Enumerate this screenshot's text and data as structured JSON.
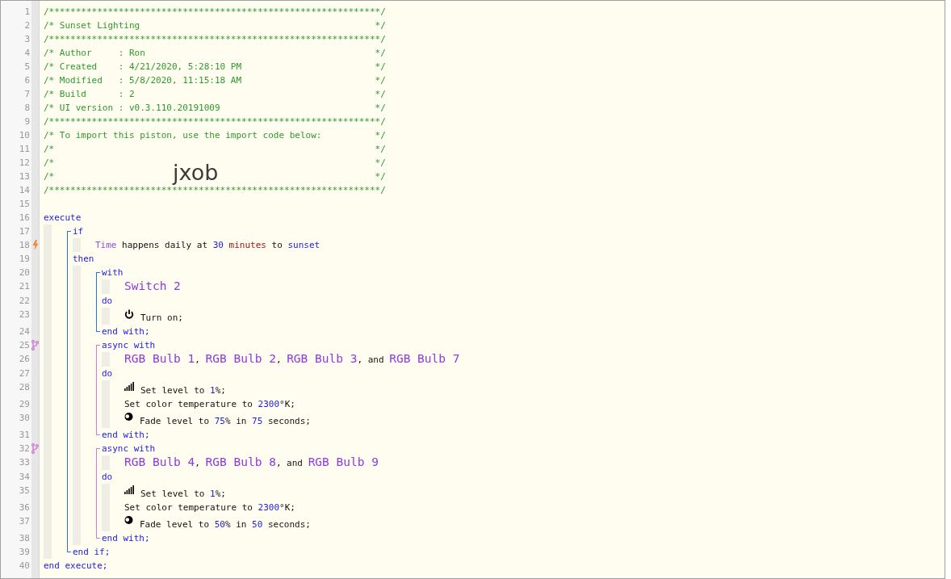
{
  "import_code": "jxob",
  "code": [
    {
      "kind": "line",
      "number": "1",
      "segments": [
        {
          "kind": "comment",
          "text": "/**************************************************************/"
        }
      ]
    },
    {
      "kind": "line",
      "number": "2",
      "segments": [
        {
          "kind": "comment-body",
          "text": "/* Sunset Lighting"
        },
        {
          "kind": "comment",
          "text": "*/"
        }
      ]
    },
    {
      "kind": "line",
      "number": "3",
      "segments": [
        {
          "kind": "comment",
          "text": "/**************************************************************/"
        }
      ]
    },
    {
      "kind": "line",
      "number": "4",
      "segments": [
        {
          "kind": "comment-body",
          "text": "/* Author     : Ron"
        },
        {
          "kind": "comment",
          "text": "*/"
        }
      ]
    },
    {
      "kind": "line",
      "number": "5",
      "segments": [
        {
          "kind": "comment-body",
          "text": "/* Created    : 4/21/2020, 5:28:10 PM"
        },
        {
          "kind": "comment",
          "text": "*/"
        }
      ]
    },
    {
      "kind": "line",
      "number": "6",
      "segments": [
        {
          "kind": "comment-body",
          "text": "/* Modified   : 5/8/2020, 11:15:18 AM"
        },
        {
          "kind": "comment",
          "text": "*/"
        }
      ]
    },
    {
      "kind": "line",
      "number": "7",
      "segments": [
        {
          "kind": "comment-body",
          "text": "/* Build      : 2"
        },
        {
          "kind": "comment",
          "text": "*/"
        }
      ]
    },
    {
      "kind": "line",
      "number": "8",
      "segments": [
        {
          "kind": "comment-body",
          "text": "/* UI version : v0.3.110.20191009"
        },
        {
          "kind": "comment",
          "text": "*/"
        }
      ]
    },
    {
      "kind": "line",
      "number": "9",
      "segments": [
        {
          "kind": "comment",
          "text": "/**************************************************************/"
        }
      ]
    },
    {
      "kind": "line",
      "number": "10",
      "segments": [
        {
          "kind": "comment-body",
          "text": "/* To import this piston, use the import code below:"
        },
        {
          "kind": "comment",
          "text": "*/"
        }
      ]
    },
    {
      "kind": "line",
      "number": "11",
      "segments": [
        {
          "kind": "comment-body",
          "text": "/*"
        },
        {
          "kind": "comment",
          "text": "*/"
        }
      ]
    },
    {
      "kind": "line",
      "number": "12",
      "segments": [
        {
          "kind": "comment-body",
          "text": "/*"
        },
        {
          "kind": "comment",
          "text": "*/"
        }
      ]
    },
    {
      "kind": "line",
      "number": "13",
      "segments": [
        {
          "kind": "comment-body",
          "text": "/*"
        },
        {
          "kind": "comment",
          "text": "*/"
        }
      ]
    },
    {
      "kind": "line",
      "number": "14",
      "segments": [
        {
          "kind": "comment",
          "text": "/**************************************************************/"
        }
      ]
    },
    {
      "kind": "line",
      "number": "15"
    },
    {
      "kind": "line",
      "number": "16",
      "segments": [
        {
          "kind": "keyword",
          "text": "execute"
        }
      ]
    },
    {
      "kind": "group",
      "children": [
        {
          "kind": "block",
          "children": [
            {
              "kind": "line",
              "number": "17",
              "segments": [
                {
                  "kind": "keyword",
                  "text": "if"
                }
              ]
            },
            {
              "kind": "group",
              "children": [
                {
                  "kind": "trigger-line",
                  "number": "18",
                  "segments": [
                    {
                      "kind": "variable",
                      "text": "Time"
                    },
                    {
                      "kind": "plain",
                      "text": " happens daily at "
                    },
                    {
                      "kind": "number",
                      "text": "30"
                    },
                    {
                      "kind": "unit",
                      "text": " minutes"
                    },
                    {
                      "kind": "plain",
                      "text": " to "
                    },
                    {
                      "kind": "literal",
                      "text": "sunset"
                    }
                  ]
                }
              ]
            },
            {
              "kind": "line",
              "number": "19",
              "segments": [
                {
                  "kind": "keyword",
                  "text": "then"
                }
              ]
            },
            {
              "kind": "group",
              "children": [
                {
                  "kind": "block",
                  "children": [
                    {
                      "kind": "line",
                      "number": "20",
                      "segments": [
                        {
                          "kind": "keyword",
                          "text": "with"
                        }
                      ]
                    },
                    {
                      "kind": "group",
                      "children": [
                        {
                          "kind": "line",
                          "number": "21",
                          "segments": [
                            {
                              "kind": "device",
                              "text": "Switch 2"
                            }
                          ]
                        }
                      ]
                    },
                    {
                      "kind": "line",
                      "number": "22",
                      "segments": [
                        {
                          "kind": "keyword",
                          "text": "do"
                        }
                      ]
                    },
                    {
                      "kind": "group",
                      "children": [
                        {
                          "kind": "power-line",
                          "number": "23",
                          "segments": [
                            {
                              "kind": "plain",
                              "text": "Turn on;"
                            }
                          ]
                        }
                      ]
                    },
                    {
                      "kind": "line",
                      "number": "24",
                      "segments": [
                        {
                          "kind": "keyword",
                          "text": "end with;"
                        }
                      ]
                    }
                  ]
                },
                {
                  "kind": "async-block",
                  "children": [
                    {
                      "kind": "async-line",
                      "number": "25",
                      "segments": [
                        {
                          "kind": "keyword",
                          "text": "async with"
                        }
                      ]
                    },
                    {
                      "kind": "group",
                      "children": [
                        {
                          "kind": "line",
                          "number": "26",
                          "segments": [
                            {
                              "kind": "device",
                              "text": "RGB Bulb 1"
                            },
                            {
                              "kind": "plain",
                              "text": ", "
                            },
                            {
                              "kind": "device",
                              "text": "RGB Bulb 2"
                            },
                            {
                              "kind": "plain",
                              "text": ", "
                            },
                            {
                              "kind": "device",
                              "text": "RGB Bulb 3"
                            },
                            {
                              "kind": "plain",
                              "text": ", and "
                            },
                            {
                              "kind": "device",
                              "text": "RGB Bulb 7"
                            }
                          ]
                        }
                      ]
                    },
                    {
                      "kind": "line",
                      "number": "27",
                      "segments": [
                        {
                          "kind": "keyword",
                          "text": "do"
                        }
                      ]
                    },
                    {
                      "kind": "group",
                      "children": [
                        {
                          "kind": "level-line",
                          "number": "28",
                          "segments": [
                            {
                              "kind": "plain",
                              "text": "Set level to "
                            },
                            {
                              "kind": "number",
                              "text": "1"
                            },
                            {
                              "kind": "plain",
                              "text": "%;"
                            }
                          ]
                        },
                        {
                          "kind": "line",
                          "number": "29",
                          "segments": [
                            {
                              "kind": "plain",
                              "text": "Set color temperature to "
                            },
                            {
                              "kind": "number",
                              "text": "2300"
                            },
                            {
                              "kind": "plain",
                              "text": "°K;"
                            }
                          ]
                        },
                        {
                          "kind": "fade-line",
                          "number": "30",
                          "segments": [
                            {
                              "kind": "plain",
                              "text": "Fade level to "
                            },
                            {
                              "kind": "number",
                              "text": "75"
                            },
                            {
                              "kind": "plain",
                              "text": "% in "
                            },
                            {
                              "kind": "number",
                              "text": "75"
                            },
                            {
                              "kind": "plain",
                              "text": " seconds;"
                            }
                          ]
                        }
                      ]
                    },
                    {
                      "kind": "line",
                      "number": "31",
                      "segments": [
                        {
                          "kind": "keyword",
                          "text": "end with;"
                        }
                      ]
                    }
                  ]
                },
                {
                  "kind": "async-block",
                  "children": [
                    {
                      "kind": "async-line",
                      "number": "32",
                      "segments": [
                        {
                          "kind": "keyword",
                          "text": "async with"
                        }
                      ]
                    },
                    {
                      "kind": "group",
                      "children": [
                        {
                          "kind": "line",
                          "number": "33",
                          "segments": [
                            {
                              "kind": "device",
                              "text": "RGB Bulb 4"
                            },
                            {
                              "kind": "plain",
                              "text": ", "
                            },
                            {
                              "kind": "device",
                              "text": "RGB Bulb 8"
                            },
                            {
                              "kind": "plain",
                              "text": ", and "
                            },
                            {
                              "kind": "device",
                              "text": "RGB Bulb 9"
                            }
                          ]
                        }
                      ]
                    },
                    {
                      "kind": "line",
                      "number": "34",
                      "segments": [
                        {
                          "kind": "keyword",
                          "text": "do"
                        }
                      ]
                    },
                    {
                      "kind": "group",
                      "children": [
                        {
                          "kind": "level-line",
                          "number": "35",
                          "segments": [
                            {
                              "kind": "plain",
                              "text": "Set level to "
                            },
                            {
                              "kind": "number",
                              "text": "1"
                            },
                            {
                              "kind": "plain",
                              "text": "%;"
                            }
                          ]
                        },
                        {
                          "kind": "line",
                          "number": "36",
                          "segments": [
                            {
                              "kind": "plain",
                              "text": "Set color temperature to "
                            },
                            {
                              "kind": "number",
                              "text": "2300"
                            },
                            {
                              "kind": "plain",
                              "text": "°K;"
                            }
                          ]
                        },
                        {
                          "kind": "fade-line",
                          "number": "37",
                          "segments": [
                            {
                              "kind": "plain",
                              "text": "Fade level to "
                            },
                            {
                              "kind": "number",
                              "text": "50"
                            },
                            {
                              "kind": "plain",
                              "text": "% in "
                            },
                            {
                              "kind": "number",
                              "text": "50"
                            },
                            {
                              "kind": "plain",
                              "text": " seconds;"
                            }
                          ]
                        }
                      ]
                    },
                    {
                      "kind": "line",
                      "number": "38",
                      "segments": [
                        {
                          "kind": "keyword",
                          "text": "end with;"
                        }
                      ]
                    }
                  ]
                }
              ]
            },
            {
              "kind": "line",
              "number": "39",
              "segments": [
                {
                  "kind": "keyword",
                  "text": "end if;"
                }
              ]
            }
          ]
        }
      ]
    },
    {
      "kind": "line",
      "number": "40",
      "segments": [
        {
          "kind": "keyword",
          "text": "end execute;"
        }
      ]
    }
  ]
}
